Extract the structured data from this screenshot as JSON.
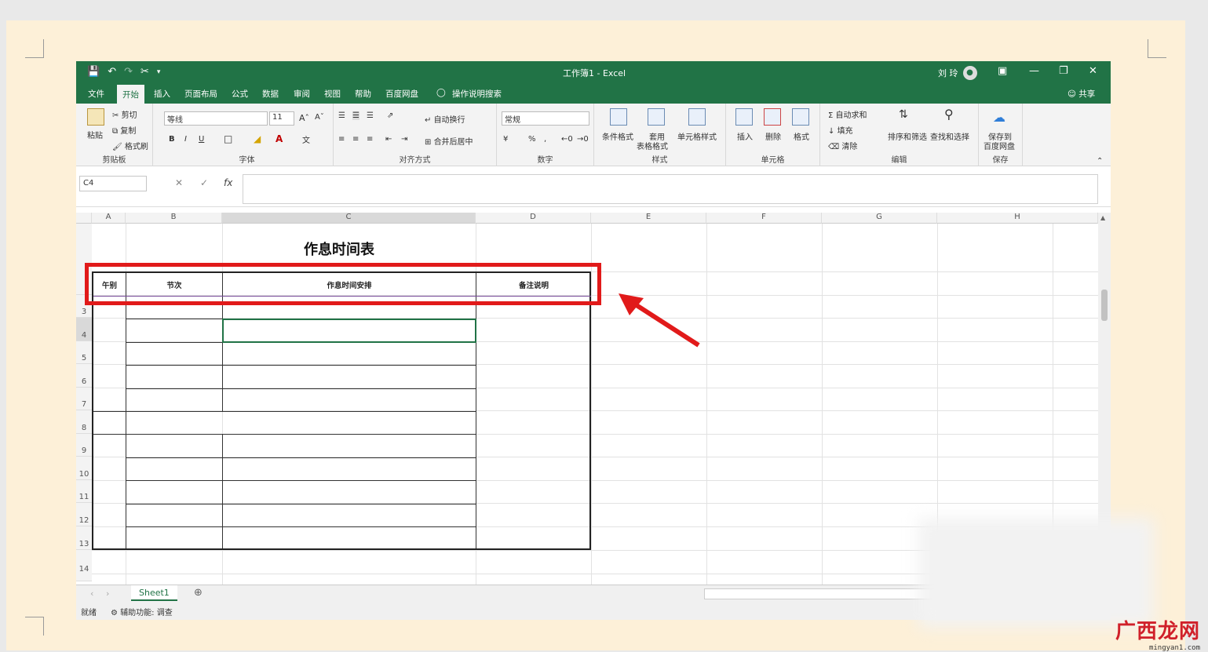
{
  "window": {
    "title": "工作簿1 - Excel",
    "user_name": "刘 玲",
    "share_label": "共享"
  },
  "tabs": [
    "文件",
    "开始",
    "插入",
    "页面布局",
    "公式",
    "数据",
    "审阅",
    "视图",
    "帮助",
    "百度网盘"
  ],
  "tell_me": "操作说明搜索",
  "ribbon": {
    "clipboard": {
      "paste": "粘贴",
      "cut": "剪切",
      "copy": "复制",
      "format_painter": "格式刷",
      "label": "剪贴板"
    },
    "font": {
      "name": "等线",
      "size": "11",
      "bold": "B",
      "italic": "I",
      "underline": "U",
      "label": "字体"
    },
    "alignment": {
      "wrap": "自动换行",
      "merge": "合并后居中",
      "label": "对齐方式"
    },
    "number": {
      "format": "常规",
      "percent": "%",
      "label": "数字"
    },
    "styles": {
      "conditional": "条件格式",
      "table": "套用",
      "table2": "表格格式",
      "cell_styles": "单元格样式",
      "label": "样式"
    },
    "cells": {
      "insert": "插入",
      "delete": "删除",
      "format": "格式",
      "label": "单元格"
    },
    "editing": {
      "autosum": "自动求和",
      "fill": "填充",
      "clear": "清除",
      "sort": "排序和筛选",
      "find": "查找和选择",
      "label": "编辑"
    },
    "save": {
      "save": "保存到",
      "save2": "百度网盘",
      "label": "保存"
    }
  },
  "formula_bar": {
    "name_box": "C4",
    "fx": "fx"
  },
  "columns": [
    "A",
    "B",
    "C",
    "D",
    "E",
    "F",
    "G",
    "H"
  ],
  "rows": [
    "3",
    "4",
    "5",
    "6",
    "7",
    "8",
    "9",
    "10",
    "11",
    "12",
    "13",
    "14"
  ],
  "sheet": {
    "title": "作息时间表",
    "headers": [
      "午别",
      "节次",
      "作息时间安排",
      "备注说明"
    ]
  },
  "sheet_tabs": [
    "Sheet1"
  ],
  "status": {
    "ready": "就绪",
    "accessibility": "辅助功能: 调查"
  },
  "watermark": {
    "logo": "广西龙网",
    "url": "mingyan1.com"
  }
}
